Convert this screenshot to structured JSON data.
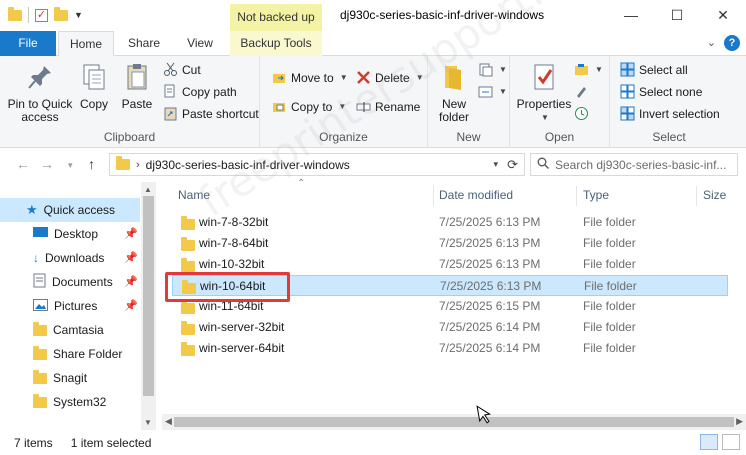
{
  "titlebar": {
    "context_badge": "Not backed up",
    "title": "dj930c-series-basic-inf-driver-windows",
    "minimize": "—",
    "maximize": "☐",
    "close": "✕"
  },
  "tabs": {
    "file": "File",
    "home": "Home",
    "share": "Share",
    "view": "View",
    "backup": "Backup Tools",
    "collapse": "⌄",
    "help": "?"
  },
  "ribbon": {
    "clipboard": {
      "label": "Clipboard",
      "pin": "Pin to Quick access",
      "copy": "Copy",
      "paste": "Paste",
      "cut": "Cut",
      "copy_path": "Copy path",
      "paste_shortcut": "Paste shortcut"
    },
    "organize": {
      "label": "Organize",
      "move_to": "Move to",
      "copy_to": "Copy to",
      "delete": "Delete",
      "rename": "Rename"
    },
    "new": {
      "label": "New",
      "new_folder": "New folder"
    },
    "open": {
      "label": "Open",
      "properties": "Properties"
    },
    "select": {
      "label": "Select",
      "select_all": "Select all",
      "select_none": "Select none",
      "invert": "Invert selection"
    }
  },
  "address": {
    "path": "dj930c-series-basic-inf-driver-windows",
    "search_placeholder": "Search dj930c-series-basic-inf..."
  },
  "navpane": {
    "items": [
      {
        "label": "Quick access"
      },
      {
        "label": "Desktop"
      },
      {
        "label": "Downloads"
      },
      {
        "label": "Documents"
      },
      {
        "label": "Pictures"
      },
      {
        "label": "Camtasia"
      },
      {
        "label": "Share Folder"
      },
      {
        "label": "Snagit"
      },
      {
        "label": "System32"
      }
    ]
  },
  "filelist": {
    "columns": {
      "name": "Name",
      "date": "Date modified",
      "type": "Type",
      "size": "Size"
    },
    "rows": [
      {
        "name": "win-7-8-32bit",
        "date": "7/25/2025 6:13 PM",
        "type": "File folder"
      },
      {
        "name": "win-7-8-64bit",
        "date": "7/25/2025 6:13 PM",
        "type": "File folder"
      },
      {
        "name": "win-10-32bit",
        "date": "7/25/2025 6:13 PM",
        "type": "File folder"
      },
      {
        "name": "win-10-64bit",
        "date": "7/25/2025 6:13 PM",
        "type": "File folder"
      },
      {
        "name": "win-11-64bit",
        "date": "7/25/2025 6:15 PM",
        "type": "File folder"
      },
      {
        "name": "win-server-32bit",
        "date": "7/25/2025 6:14 PM",
        "type": "File folder"
      },
      {
        "name": "win-server-64bit",
        "date": "7/25/2025 6:14 PM",
        "type": "File folder"
      }
    ],
    "selected_index": 3
  },
  "status": {
    "items": "7 items",
    "selected": "1 item selected"
  },
  "watermark": "freeprintersupport.com",
  "colors": {
    "accent": "#1979ca",
    "selection": "#cce8ff",
    "highlight": "#e03a3a",
    "folder": "#f3c94a"
  }
}
